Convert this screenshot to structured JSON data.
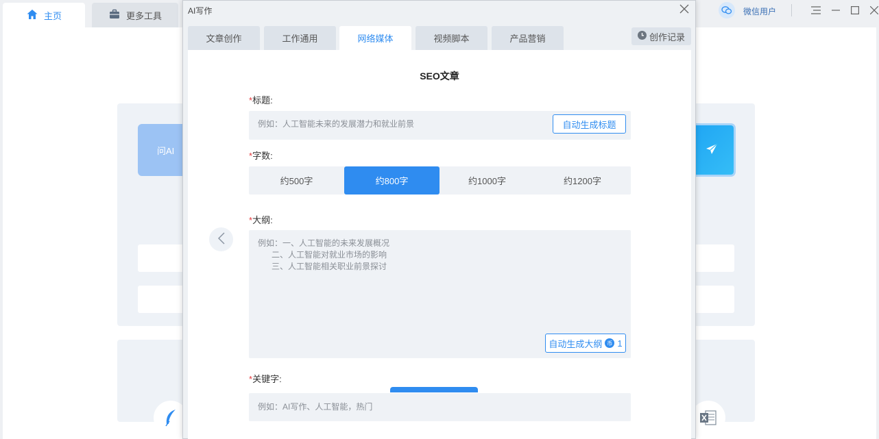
{
  "app": {
    "tabs": [
      {
        "label": "主页",
        "icon": "home-icon"
      },
      {
        "label": "更多工具",
        "icon": "toolbox-icon"
      }
    ],
    "user": "微信用户",
    "ask_ai": "问AI"
  },
  "dialog": {
    "title": "AI写作",
    "tabs": [
      "文章创作",
      "工作通用",
      "网络媒体",
      "视频脚本",
      "产品营销"
    ],
    "active_tab": "网络媒体",
    "history_label": "创作记录",
    "form_title": "SEO文章",
    "title_field": {
      "label": "标题:",
      "placeholder": "例如：人工智能未来的发展潜力和就业前景",
      "auto_button": "自动生成标题"
    },
    "word_count": {
      "label": "字数:",
      "options": [
        "约500字",
        "约800字",
        "约1000字",
        "约1200字"
      ],
      "selected": "约800字"
    },
    "outline_field": {
      "label": "大纲:",
      "placeholder": "例如：一、人工智能的未来发展概况\n      二、人工智能对就业市场的影响\n      三、人工智能相关职业前景探讨",
      "auto_button": "自动生成大纲",
      "cost": "1"
    },
    "keywords_field": {
      "label": "关键字:",
      "placeholder": "例如：AI写作、人工智能，热门"
    }
  },
  "colors": {
    "accent": "#2f8cf0",
    "required": "#e4393c"
  }
}
